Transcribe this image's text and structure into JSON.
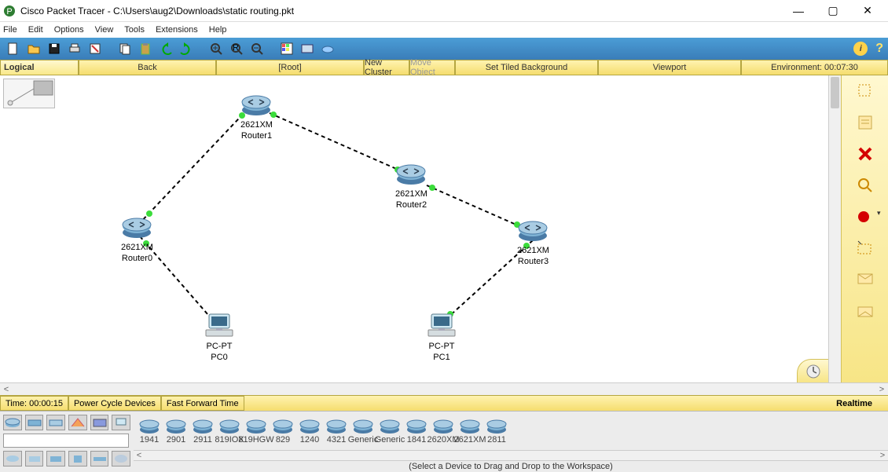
{
  "title": "Cisco Packet Tracer - C:\\Users\\aug2\\Downloads\\static routing.pkt",
  "menu": [
    "File",
    "Edit",
    "Options",
    "View",
    "Tools",
    "Extensions",
    "Help"
  ],
  "nav": {
    "logical": "Logical",
    "back": "Back",
    "root": "[Root]",
    "newcluster": "New Cluster",
    "moveobj": "Move Object",
    "tiled": "Set Tiled Background",
    "viewport": "Viewport",
    "env": "Environment: 00:07:30"
  },
  "devices": {
    "r0": {
      "model": "2621XM",
      "name": "Router0"
    },
    "r1": {
      "model": "2621XM",
      "name": "Router1"
    },
    "r2": {
      "model": "2621XM",
      "name": "Router2"
    },
    "r3": {
      "model": "2621XM",
      "name": "Router3"
    },
    "pc0": {
      "model": "PC-PT",
      "name": "PC0"
    },
    "pc1": {
      "model": "PC-PT",
      "name": "PC1"
    }
  },
  "status": {
    "time": "Time: 00:00:15",
    "pcd": "Power Cycle Devices",
    "fft": "Fast Forward Time",
    "realtime": "Realtime"
  },
  "palette": [
    "1941",
    "2901",
    "2911",
    "819IOX",
    "819HGW",
    "829",
    "1240",
    "4321",
    "Generic",
    "Generic",
    "1841",
    "2620XM",
    "2621XM",
    "2811"
  ],
  "hint": "(Select a Device to Drag and Drop to the Workspace)"
}
